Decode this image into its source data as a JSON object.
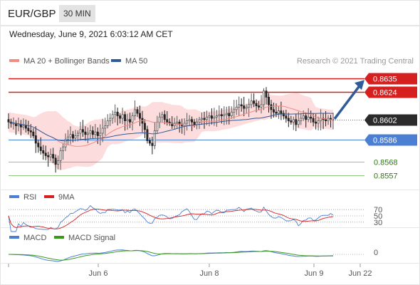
{
  "header": {
    "pair": "EUR/GBP",
    "timeframe": "30 MIN"
  },
  "timestamp": "Wednesday, June 9, 2021 6:03:12 AM CET",
  "legend": {
    "main": [
      {
        "label": "MA 20 + Bollinger Bands",
        "color": "#f28b82"
      },
      {
        "label": "MA 50",
        "color": "#2f5b9a"
      }
    ],
    "rsi": [
      {
        "label": "RSI",
        "color": "#4a7fd4"
      },
      {
        "label": "9MA",
        "color": "#d62020"
      }
    ],
    "macd": [
      {
        "label": "MACD",
        "color": "#4a7fd4"
      },
      {
        "label": "MACD Signal",
        "color": "#3a9a1a"
      }
    ]
  },
  "copyright": "Research © 2021 Trading Central",
  "chart_data": {
    "type": "candlestick",
    "x_ticks": [
      "Jun 6",
      "Jun 8",
      "Jun 9",
      "Jun 22"
    ],
    "ylim": [
      0.8548,
      0.8642
    ],
    "current_price": "0.8602",
    "levels": [
      {
        "label": "0.8635",
        "value": 0.8635,
        "kind": "resistance"
      },
      {
        "label": "0.8624",
        "value": 0.8624,
        "kind": "resistance"
      },
      {
        "label": "0.8586",
        "value": 0.8586,
        "kind": "pivot"
      },
      {
        "label": "0.8568",
        "value": 0.8568,
        "kind": "support"
      },
      {
        "label": "0.8557",
        "value": 0.8557,
        "kind": "support"
      }
    ],
    "close": [
      0.86,
      0.8599,
      0.8599,
      0.8597,
      0.8598,
      0.8596,
      0.8597,
      0.8595,
      0.8593,
      0.8592,
      0.8589,
      0.8583,
      0.858,
      0.8577,
      0.8575,
      0.8573,
      0.8572,
      0.8574,
      0.8571,
      0.8566,
      0.8569,
      0.8577,
      0.858,
      0.8586,
      0.8588,
      0.859,
      0.8587,
      0.8589,
      0.8591,
      0.8594,
      0.8592,
      0.859,
      0.8591,
      0.8593,
      0.859,
      0.8592,
      0.8589,
      0.8591,
      0.8595,
      0.8597,
      0.8601,
      0.8603,
      0.8606,
      0.8608,
      0.8605,
      0.8603,
      0.8606,
      0.8601,
      0.8602,
      0.86,
      0.8605,
      0.861,
      0.8607,
      0.8603,
      0.8599,
      0.8594,
      0.8585,
      0.8583,
      0.8581,
      0.8593,
      0.86,
      0.8604,
      0.8606,
      0.8602,
      0.86,
      0.8599,
      0.8597,
      0.8599,
      0.86,
      0.8598,
      0.8597,
      0.8599,
      0.8601,
      0.8602,
      0.86,
      0.8598,
      0.86,
      0.8602,
      0.8603,
      0.8602,
      0.8604,
      0.8605,
      0.8603,
      0.8604,
      0.8605,
      0.8606,
      0.8605,
      0.8606,
      0.8607,
      0.8605,
      0.8608,
      0.861,
      0.8612,
      0.8614,
      0.8613,
      0.8611,
      0.8612,
      0.8614,
      0.8617,
      0.8615,
      0.8613,
      0.8612,
      0.8614,
      0.8625,
      0.862,
      0.8614,
      0.861,
      0.8608,
      0.8607,
      0.8609,
      0.8607,
      0.8605,
      0.8603,
      0.8601,
      0.86,
      0.8602,
      0.8598,
      0.8601,
      0.8603,
      0.8605,
      0.8602,
      0.8604,
      0.8603,
      0.86,
      0.8599,
      0.8601,
      0.8603,
      0.8602,
      0.8601,
      0.8603,
      0.8602,
      0.8602
    ],
    "projection": {
      "from": 0.8602,
      "to": 0.8635
    },
    "rsi_levels": [
      70,
      50,
      30
    ],
    "macd_zero": 0
  }
}
